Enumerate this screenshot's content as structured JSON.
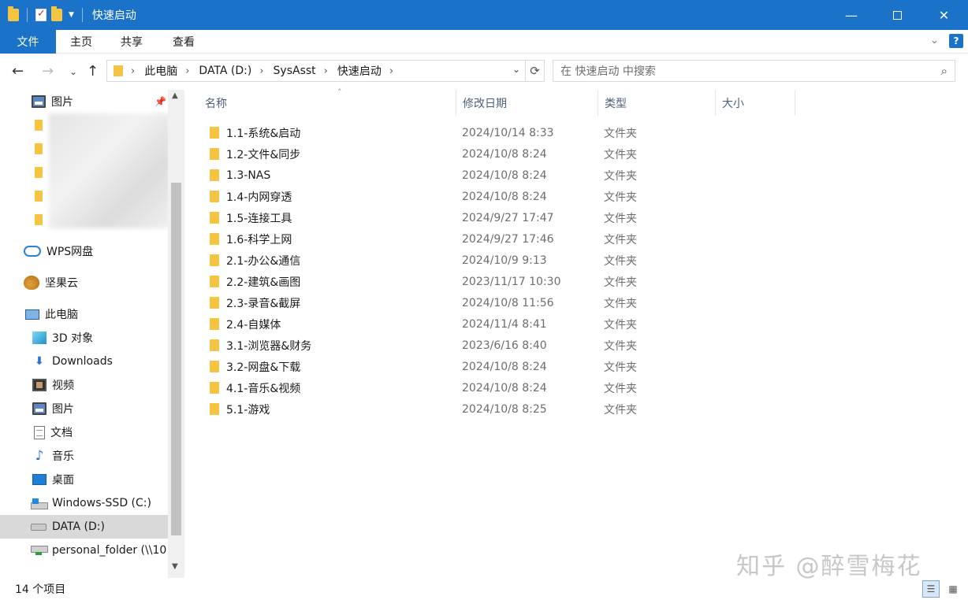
{
  "window": {
    "title": "快速启动",
    "minimize": "—",
    "close": "✕"
  },
  "ribbon": {
    "tabs": [
      "文件",
      "主页",
      "共享",
      "查看"
    ],
    "help": "?"
  },
  "address": {
    "crumbs": [
      "此电脑",
      "DATA (D:)",
      "SysAsst",
      "快速启动"
    ],
    "search_placeholder": "在 快速启动 中搜索"
  },
  "sidebar": {
    "items": [
      {
        "label": "图片",
        "icon": "picture-icon"
      },
      {
        "label": "WPS网盘",
        "icon": "cloud-icon"
      },
      {
        "label": "坚果云",
        "icon": "nut-icon"
      },
      {
        "label": "此电脑",
        "icon": "computer-icon"
      },
      {
        "label": "3D 对象",
        "icon": "cube-icon"
      },
      {
        "label": "Downloads",
        "icon": "download-icon"
      },
      {
        "label": "视频",
        "icon": "video-icon"
      },
      {
        "label": "图片",
        "icon": "picture-icon"
      },
      {
        "label": "文档",
        "icon": "document-icon"
      },
      {
        "label": "音乐",
        "icon": "music-icon"
      },
      {
        "label": "桌面",
        "icon": "desktop-icon"
      },
      {
        "label": "Windows-SSD (C:)",
        "icon": "windows-drive-icon"
      },
      {
        "label": "DATA (D:)",
        "icon": "drive-icon"
      },
      {
        "label": "personal_folder (\\\\10",
        "icon": "network-drive-icon"
      }
    ]
  },
  "columns": {
    "name": "名称",
    "date": "修改日期",
    "type": "类型",
    "size": "大小"
  },
  "files": [
    {
      "name": "1.1-系统&启动",
      "date": "2024/10/14 8:33",
      "type": "文件夹"
    },
    {
      "name": "1.2-文件&同步",
      "date": "2024/10/8 8:24",
      "type": "文件夹"
    },
    {
      "name": "1.3-NAS",
      "date": "2024/10/8 8:24",
      "type": "文件夹"
    },
    {
      "name": "1.4-内网穿透",
      "date": "2024/10/8 8:24",
      "type": "文件夹"
    },
    {
      "name": "1.5-连接工具",
      "date": "2024/9/27 17:47",
      "type": "文件夹"
    },
    {
      "name": "1.6-科学上网",
      "date": "2024/9/27 17:46",
      "type": "文件夹"
    },
    {
      "name": "2.1-办公&通信",
      "date": "2024/10/9 9:13",
      "type": "文件夹"
    },
    {
      "name": "2.2-建筑&画图",
      "date": "2023/11/17 10:30",
      "type": "文件夹"
    },
    {
      "name": "2.3-录音&截屏",
      "date": "2024/10/8 11:56",
      "type": "文件夹"
    },
    {
      "name": "2.4-自媒体",
      "date": "2024/11/4 8:41",
      "type": "文件夹"
    },
    {
      "name": "3.1-浏览器&财务",
      "date": "2023/6/16 8:40",
      "type": "文件夹"
    },
    {
      "name": "3.2-网盘&下载",
      "date": "2024/10/8 8:24",
      "type": "文件夹"
    },
    {
      "name": "4.1-音乐&视频",
      "date": "2024/10/8 8:24",
      "type": "文件夹"
    },
    {
      "name": "5.1-游戏",
      "date": "2024/10/8 8:25",
      "type": "文件夹"
    }
  ],
  "status": {
    "count": "14 个项目"
  },
  "watermark": "知乎 @醉雪梅花",
  "colors": {
    "accent": "#1a73c9",
    "folder": "#f5c443",
    "selected": "#d9d9d9"
  }
}
